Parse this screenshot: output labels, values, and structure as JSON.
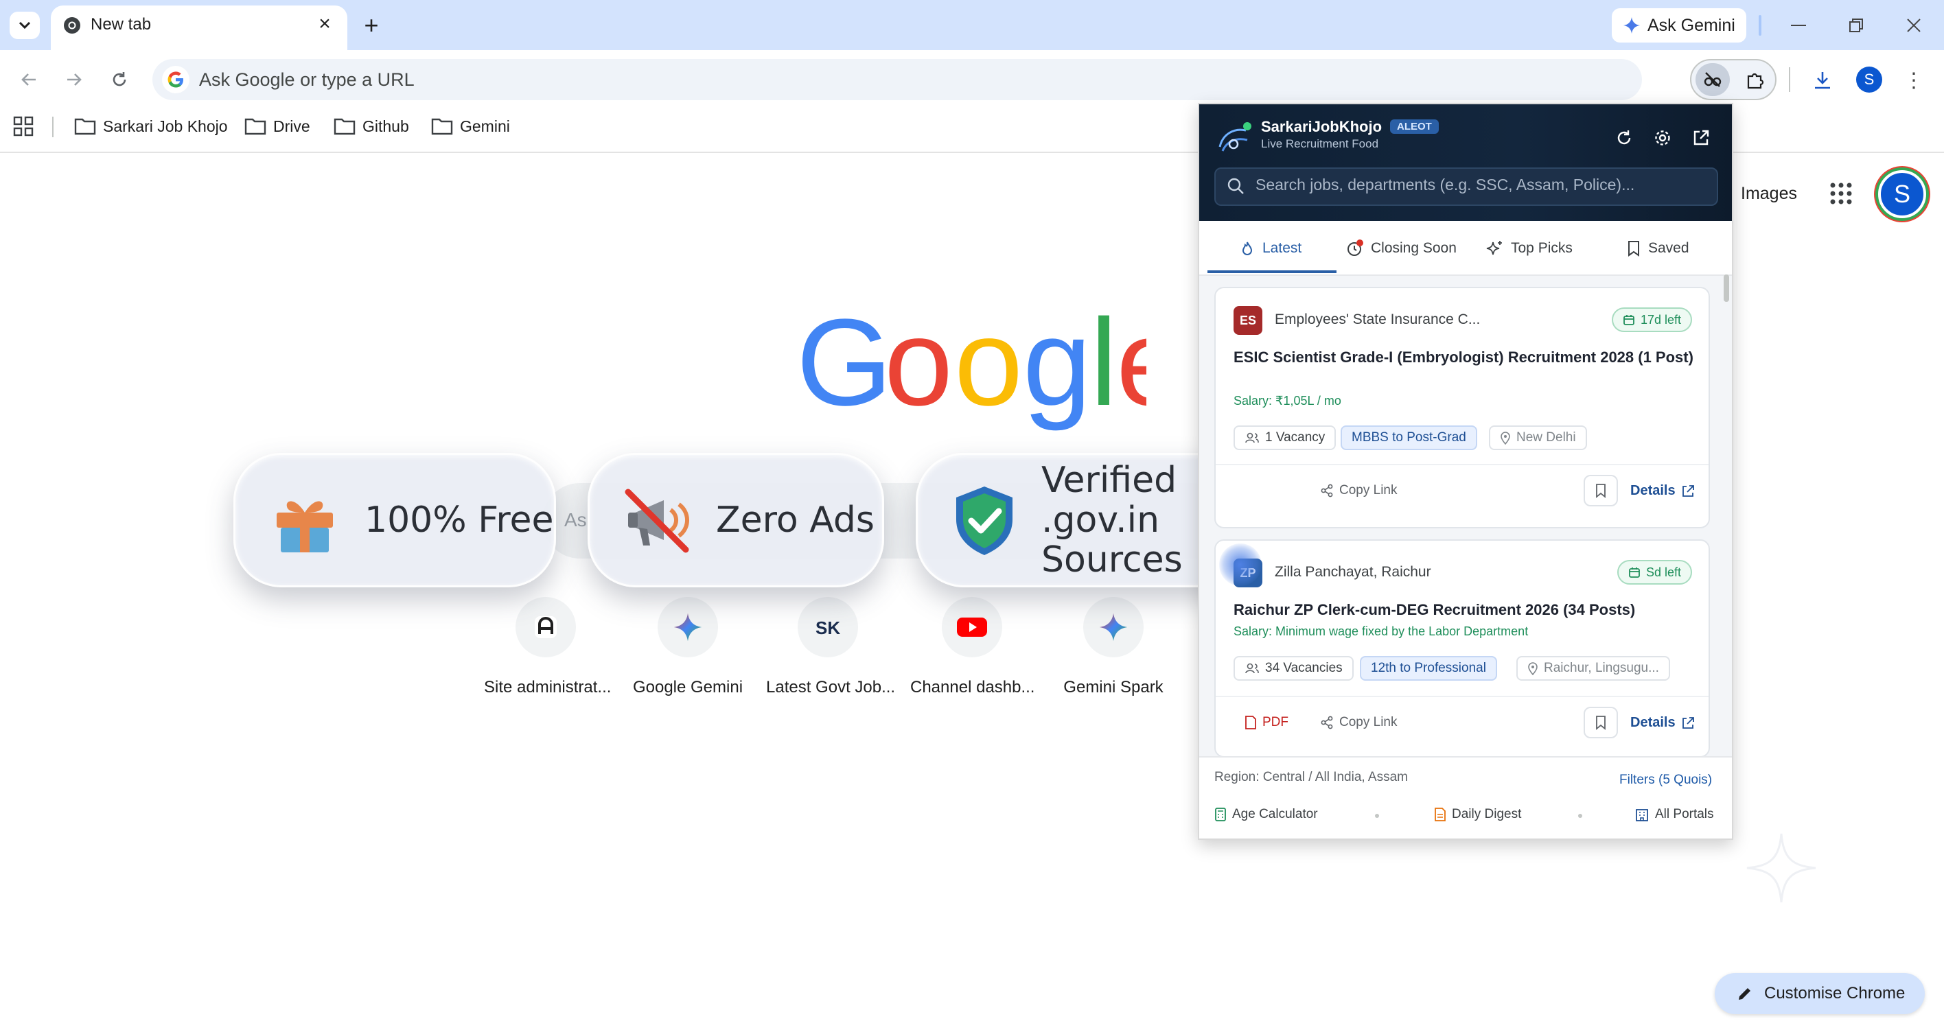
{
  "browser": {
    "tab": {
      "title": "New tab"
    },
    "ask_gemini_label": "Ask Gemini",
    "omnibox": {
      "placeholder": "Ask Google or type a URL"
    },
    "profile_initial": "S",
    "bookmarks": [
      {
        "label": "Sarkari Job Khojo"
      },
      {
        "label": "Drive"
      },
      {
        "label": "Github"
      },
      {
        "label": "Gemini"
      }
    ]
  },
  "ntp": {
    "images_link": "Images",
    "avatar_initial": "S",
    "search_placeholder_partial": "As",
    "shortcuts": [
      {
        "label": "Site administrat...",
        "icon": "site-admin-icon"
      },
      {
        "label": "Google Gemini",
        "icon": "gemini-icon"
      },
      {
        "label": "Latest Govt Job...",
        "icon": "sk-logo-icon"
      },
      {
        "label": "Channel dashb...",
        "icon": "youtube-icon"
      },
      {
        "label": "Gemini Spark",
        "icon": "gemini-icon"
      }
    ],
    "customise_label": "Customise Chrome"
  },
  "badges": [
    {
      "text": "100% Free",
      "icon": "gift-icon"
    },
    {
      "text": "Zero Ads",
      "icon": "no-ads-megaphone-icon"
    },
    {
      "text_line1": "Verified .gov.in",
      "text_line2": "Sources",
      "icon": "verified-shield-icon"
    }
  ],
  "popup": {
    "title": "SarkariJobKhojo",
    "tag": "ALEOT",
    "subtitle": "Live Recruitment Food",
    "search_placeholder": "Search jobs, departments (e.g. SSC, Assam, Police)...",
    "tabs": [
      {
        "label": "Latest",
        "active": true
      },
      {
        "label": "Closing Soon"
      },
      {
        "label": "Top Picks"
      },
      {
        "label": "Saved"
      }
    ],
    "jobs": [
      {
        "org_abbr": "ES",
        "org": "Employees' State Insurance C...",
        "days_left": "17d left",
        "title": "ESIC Scientist Grade-I (Embryologist) Recruitment 2028 (1 Post)",
        "salary": "Salary: ₹1,05L / mo",
        "vacancy": "1 Vacancy",
        "qualification": "MBBS to Post-Grad",
        "location": "New Delhi",
        "copy_link": "Copy Link",
        "details": "Details"
      },
      {
        "org_abbr": "ZP",
        "org": "Zilla Panchayat, Raichur",
        "days_left": "Sd left",
        "title": "Raichur ZP Clerk-cum-DEG Recruitment 2026 (34 Posts)",
        "salary": "Salary: Minimum wage fixed by the Labor Department",
        "vacancy": "34 Vacancies",
        "qualification": "12th to Professional",
        "location": "Raichur, Lingsugu...",
        "pdf": "PDF",
        "copy_link": "Copy Link",
        "details": "Details"
      }
    ],
    "footer": {
      "region": "Region: Central / All India, Assam",
      "filters": "Filters (5 Quois)",
      "tools": [
        "Age Calculator",
        "Daily Digest",
        "All Portals"
      ]
    }
  },
  "colors": {
    "tabstrip": "#d3e3fd",
    "popup_header": "#13263d",
    "accent_blue": "#2a5fa6",
    "salary_green": "#1e8e5a",
    "pdf_red": "#c5221f"
  }
}
